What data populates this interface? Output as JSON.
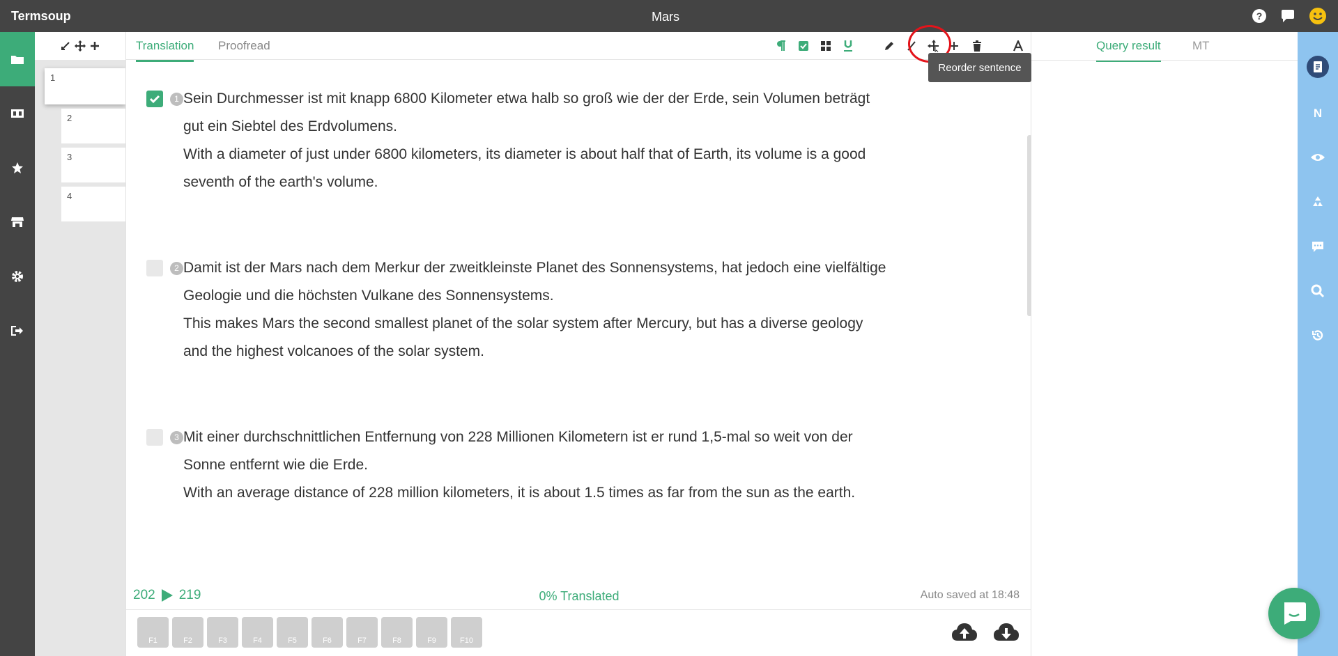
{
  "app": {
    "brand": "Termsoup",
    "document_title": "Mars"
  },
  "header_icons": [
    "help-icon",
    "chat-bubble-icon",
    "smiley-face-icon"
  ],
  "left_nav": [
    "folder-icon",
    "film-icon",
    "star-icon",
    "store-icon",
    "gear-icon",
    "logout-icon"
  ],
  "thumbnails": {
    "tools": [
      "shrink-icon",
      "move-icon",
      "plus-icon"
    ],
    "items": [
      "1",
      "2",
      "3",
      "4"
    ]
  },
  "editor": {
    "tabs": [
      "Translation",
      "Proofread"
    ],
    "toolbar_icons": [
      "paragraph-icon",
      "checkbox-icon",
      "grid-icon",
      "underline-icon",
      "pencil-icon",
      "cut-icon",
      "reorder-icon",
      "plus-icon",
      "trash-icon",
      "font-icon"
    ],
    "tooltip": "Reorder sentence",
    "segments": [
      {
        "number": "1",
        "checked": true,
        "source_line1": "Sein Durchmesser ist mit knapp 6800 Kilometer etwa halb so groß wie der der Erde, sein Volumen beträgt",
        "source_line2": "gut ein Siebtel des Erdvolumens.",
        "target_line1": "With a diameter of just under 6800 kilometers, its diameter is about half that of Earth, its volume is a good",
        "target_line2": "seventh of the earth's volume."
      },
      {
        "number": "2",
        "checked": false,
        "source_line1": "Damit ist der Mars nach dem Merkur der zweitkleinste Planet des Sonnensystems, hat jedoch eine vielfältige",
        "source_line2": "Geologie und die höchsten Vulkane des Sonnensystems.",
        "target_line1": "This makes Mars the second smallest planet of the solar system after Mercury, but has a diverse geology",
        "target_line2": "and the highest volcanoes of the solar system."
      },
      {
        "number": "3",
        "checked": false,
        "source_line1": "Mit einer durchschnittlichen Entfernung von 228 Millionen Kilometern ist er rund 1,5-mal so weit von der",
        "source_line2": "Sonne entfernt wie die Erde.",
        "target_line1": "With an average distance of 228 million kilometers, it is about 1.5 times as far from the sun as the earth.",
        "target_line2": ""
      }
    ],
    "status": {
      "source_count": "202",
      "target_count": "219",
      "progress": "0% Translated",
      "autosave": "Auto saved at 18:48"
    },
    "fkeys": [
      "F1",
      "F2",
      "F3",
      "F4",
      "F5",
      "F6",
      "F7",
      "F8",
      "F9",
      "F10"
    ],
    "cloud_icons": [
      "cloud-upload-icon",
      "cloud-download-icon"
    ]
  },
  "right_panel": {
    "tabs": [
      "Query result",
      "MT"
    ]
  },
  "right_nav": [
    "document-icon",
    "n-letter-icon",
    "eye-icon",
    "recycle-icon",
    "comment-icon",
    "search-icon",
    "history-icon"
  ],
  "colors": {
    "accent": "#3dac79",
    "dark": "#444444",
    "right_bar": "#8ec4ef",
    "tooltip": "#555555",
    "highlight_circle": "#e3141b"
  }
}
